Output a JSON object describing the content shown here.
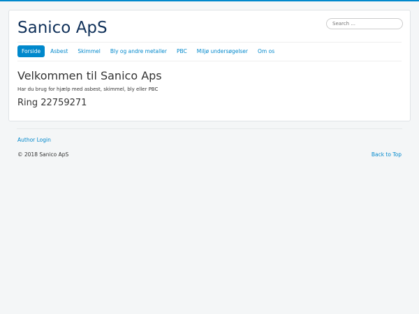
{
  "site": {
    "title": "Sanico ApS",
    "search_placeholder": "Search ..."
  },
  "nav": [
    {
      "label": "Forside",
      "active": true
    },
    {
      "label": "Asbest"
    },
    {
      "label": "Skimmel"
    },
    {
      "label": "Bly og andre metaller"
    },
    {
      "label": "PBC"
    },
    {
      "label": "Miljø undersøgelser"
    },
    {
      "label": "Om os"
    }
  ],
  "content": {
    "heading": "Velkommen til Sanico Aps",
    "text": "Har du brug for hjælp med asbest, skimmel, bly eller PBC",
    "phone": "Ring 22759271"
  },
  "footer": {
    "login": "Author Login",
    "copyright": "© 2018 Sanico ApS",
    "back_to_top": "Back to Top"
  }
}
